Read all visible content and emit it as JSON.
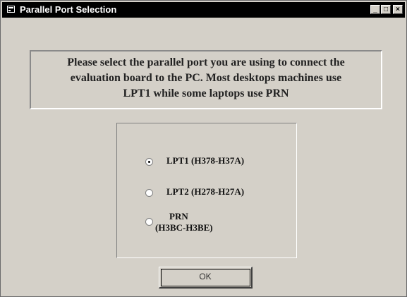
{
  "window": {
    "title": "Parallel Port Selection",
    "min_glyph": "_",
    "max_glyph": "□",
    "close_glyph": "×"
  },
  "message": {
    "line1": "Please select the parallel port you are using to connect the",
    "line2": "evaluation board to the PC. Most desktops machines use",
    "line3": "LPT1 while some laptops use PRN"
  },
  "options": [
    {
      "label": "LPT1 (H378-H37A)",
      "selected": true
    },
    {
      "label": "LPT2 (H278-H27A)",
      "selected": false
    },
    {
      "label_line1": "PRN",
      "label_line2": "(H3BC-H3BE)",
      "selected": false
    }
  ],
  "ok_label": "OK",
  "colors": {
    "title_bar": "#000000",
    "window_bg": "#d4d0c8"
  }
}
